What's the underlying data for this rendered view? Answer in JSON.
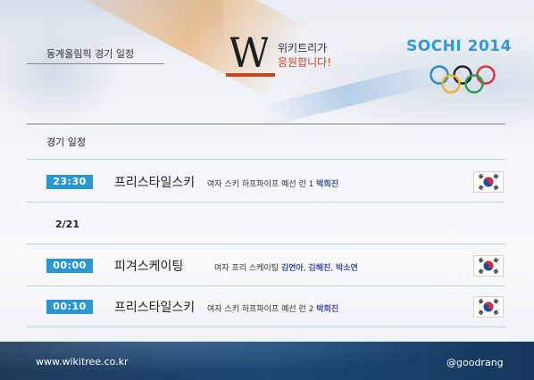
{
  "header": {
    "category_label": "동계올림픽 경기 일정",
    "logo_letter": "W",
    "cheer_line1": "위키트리가",
    "cheer_line2": "응원합니다!",
    "sochi_logo_text": "SOCHI 2014"
  },
  "schedule": {
    "title": "경기 일정",
    "rows": [
      {
        "time": "23:30",
        "sport": "프리스타일스키",
        "event": "여자 스키 하프파이프 예선 런 1",
        "athletes": [
          "박희진"
        ],
        "flag": "korea-flag"
      },
      {
        "date": "2/21"
      },
      {
        "time": "00:00",
        "sport": "피겨스케이팅",
        "event": "여자 프리 스케이팅",
        "athletes": [
          "김연아",
          "김해진",
          "박소연"
        ],
        "flag": "korea-flag"
      },
      {
        "time": "00:10",
        "sport": "프리스타일스키",
        "event": "여자 스키 하프파이프 예선 런 2",
        "athletes": [
          "박희진"
        ],
        "flag": "korea-flag"
      }
    ]
  },
  "footer": {
    "website": "www.wikitree.co.kr",
    "handle": "@goodrang"
  },
  "colors": {
    "time_badge": "#2a97d2",
    "athlete_text": "#3a4d9c",
    "logo_accent": "#c4481f",
    "sochi_blue": "#2f9bd6",
    "footer_bg": "#1b4773"
  },
  "icons": [
    "wikitree-logo",
    "olympic-rings-icon",
    "korea-flag-icon"
  ]
}
